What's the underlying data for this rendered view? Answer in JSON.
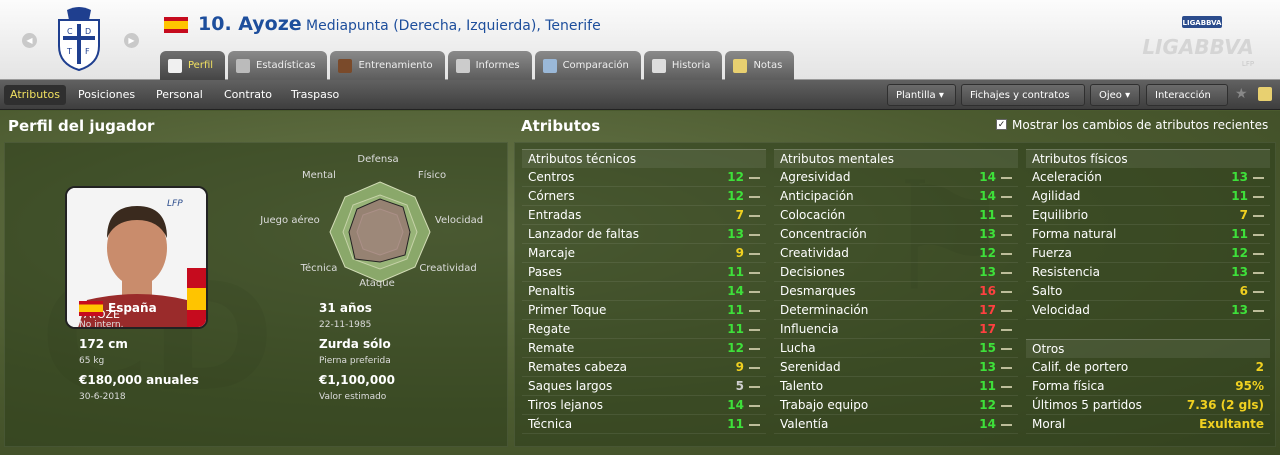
{
  "header": {
    "player_number_name": "10. Ayoze",
    "subtitle": "Mediapunta (Derecha, Izquierda), Tenerife",
    "league_logo_text": "LIGABBVA",
    "league_logo_small": "LFP",
    "tabs": [
      {
        "label": "Perfil",
        "icon": "profile-icon",
        "active": true
      },
      {
        "label": "Estadísticas",
        "icon": "stats-icon",
        "active": false
      },
      {
        "label": "Entrenamiento",
        "icon": "ball-icon",
        "active": false
      },
      {
        "label": "Informes",
        "icon": "report-icon",
        "active": false
      },
      {
        "label": "Comparación",
        "icon": "compare-icon",
        "active": false
      },
      {
        "label": "Historia",
        "icon": "history-icon",
        "active": false
      },
      {
        "label": "Notas",
        "icon": "notes-icon",
        "active": false
      }
    ]
  },
  "subnav": {
    "items": [
      "Atributos",
      "Posiciones",
      "Personal",
      "Contrato",
      "Traspaso"
    ],
    "active": "Atributos",
    "dropdowns": [
      "Plantilla",
      "Fichajes y contratos",
      "Ojeo",
      "Interacción"
    ]
  },
  "profile": {
    "title": "Perfil del jugador",
    "photo_name": "AYOZE",
    "radar_labels": {
      "top": "Defensa",
      "top_right": "Físico",
      "right": "Velocidad",
      "bottom_right": "Creatividad",
      "bottom": "Ataque",
      "bottom_left": "Técnica",
      "left": "Juego aéreo",
      "top_left": "Mental"
    },
    "nation": "España",
    "nation_sub": "No intern.",
    "age": "31 años",
    "birth": "22-11-1985",
    "height": "172 cm",
    "weight": "65 kg",
    "foot": "Zurda sólo",
    "foot_sub": "Pierna preferida",
    "wage": "€180,000 anuales",
    "contract_end": "30-6-2018",
    "value": "€1,100,000",
    "value_sub": "Valor estimado"
  },
  "attributes": {
    "title": "Atributos",
    "show_changes_label": "Mostrar los cambios de atributos recientes",
    "show_changes_checked": true,
    "technical": {
      "title": "Atributos técnicos",
      "rows": [
        {
          "name": "Centros",
          "value": "12"
        },
        {
          "name": "Córners",
          "value": "12"
        },
        {
          "name": "Entradas",
          "value": "7"
        },
        {
          "name": "Lanzador de faltas",
          "value": "13"
        },
        {
          "name": "Marcaje",
          "value": "9"
        },
        {
          "name": "Pases",
          "value": "11"
        },
        {
          "name": "Penaltis",
          "value": "14"
        },
        {
          "name": "Primer Toque",
          "value": "11"
        },
        {
          "name": "Regate",
          "value": "11"
        },
        {
          "name": "Remate",
          "value": "12"
        },
        {
          "name": "Remates cabeza",
          "value": "9"
        },
        {
          "name": "Saques largos",
          "value": "5"
        },
        {
          "name": "Tiros lejanos",
          "value": "14"
        },
        {
          "name": "Técnica",
          "value": "11"
        }
      ]
    },
    "mental": {
      "title": "Atributos mentales",
      "rows": [
        {
          "name": "Agresividad",
          "value": "14"
        },
        {
          "name": "Anticipación",
          "value": "14"
        },
        {
          "name": "Colocación",
          "value": "11"
        },
        {
          "name": "Concentración",
          "value": "13"
        },
        {
          "name": "Creatividad",
          "value": "12"
        },
        {
          "name": "Decisiones",
          "value": "13"
        },
        {
          "name": "Desmarques",
          "value": "16"
        },
        {
          "name": "Determinación",
          "value": "17"
        },
        {
          "name": "Influencia",
          "value": "17"
        },
        {
          "name": "Lucha",
          "value": "15"
        },
        {
          "name": "Serenidad",
          "value": "13"
        },
        {
          "name": "Talento",
          "value": "11"
        },
        {
          "name": "Trabajo equipo",
          "value": "12"
        },
        {
          "name": "Valentía",
          "value": "14"
        }
      ]
    },
    "physical": {
      "title": "Atributos físicos",
      "rows": [
        {
          "name": "Aceleración",
          "value": "13"
        },
        {
          "name": "Agilidad",
          "value": "11"
        },
        {
          "name": "Equilibrio",
          "value": "7"
        },
        {
          "name": "Forma natural",
          "value": "11"
        },
        {
          "name": "Fuerza",
          "value": "12"
        },
        {
          "name": "Resistencia",
          "value": "13"
        },
        {
          "name": "Salto",
          "value": "6"
        },
        {
          "name": "Velocidad",
          "value": "13"
        }
      ]
    },
    "others": {
      "title": "Otros",
      "rows": [
        {
          "name": "Calif. de portero",
          "value": "2"
        },
        {
          "name": "Forma física",
          "value": "95%"
        },
        {
          "name": "Últimos 5 partidos",
          "value": "7.36 (2 gls)"
        },
        {
          "name": "Moral",
          "value": "Exultante"
        }
      ]
    }
  },
  "colors": {
    "title_blue": "#1d4e9c",
    "value_green": "#3ee03a",
    "value_yellow": "#f0d020",
    "value_red": "#ff4040",
    "value_grey": "#cfcfcf",
    "active_tab": "#f0e060"
  }
}
